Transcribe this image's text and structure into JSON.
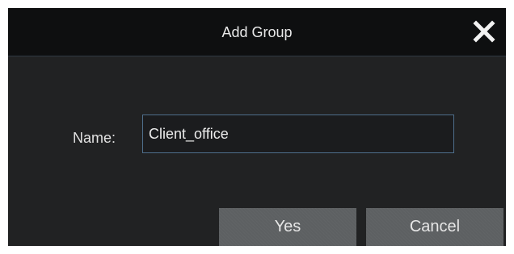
{
  "dialog": {
    "title": "Add Group",
    "close_icon": "close-icon",
    "name_label": "Name:",
    "name_value": "Client_office",
    "yes_label": "Yes",
    "cancel_label": "Cancel"
  },
  "colors": {
    "dialog_background": "#212223",
    "titlebar_background": "#0e0f10",
    "input_border": "#4f6f8c",
    "button_background": "#5d6062",
    "text": "#e8e8e8"
  }
}
